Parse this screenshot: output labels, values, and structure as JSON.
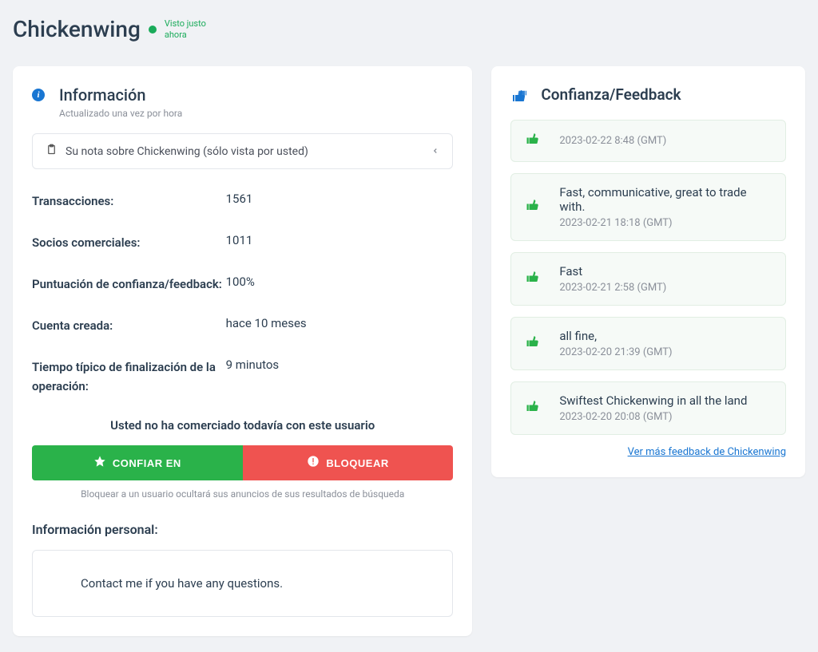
{
  "header": {
    "username": "Chickenwing",
    "status": "Visto justo ahora"
  },
  "info": {
    "title": "Información",
    "subtitle": "Actualizado una vez por hora",
    "note_label": "Su nota sobre Chickenwing (sólo vista por usted)",
    "rows": [
      {
        "label": "Transacciones:",
        "value": "1561"
      },
      {
        "label": "Socios comerciales:",
        "value": "1011"
      },
      {
        "label": "Puntuación de confianza/feedback:",
        "value": "100%"
      },
      {
        "label": "Cuenta creada:",
        "value": "hace 10 meses"
      },
      {
        "label": "Tiempo típico de finalización de la operación:",
        "value": "9 minutos"
      }
    ],
    "not_traded": "Usted no ha comerciado todavía con este usuario",
    "trust_button": "CONFIAR EN",
    "block_button": "BLOQUEAR",
    "block_hint": "Bloquear a un usuario ocultará sus anuncios de sus resultados de búsqueda",
    "personal_title": "Información personal:",
    "personal_text": "Contact me if you have any questions."
  },
  "trust": {
    "title": "Confianza/Feedback",
    "items": [
      {
        "msg": "",
        "date": "2023-02-22 8:48 (GMT)"
      },
      {
        "msg": "Fast, communicative, great to trade with.",
        "date": "2023-02-21 18:18 (GMT)"
      },
      {
        "msg": "Fast",
        "date": "2023-02-21 2:58 (GMT)"
      },
      {
        "msg": "all fine,",
        "date": "2023-02-20 21:39 (GMT)"
      },
      {
        "msg": "Swiftest Chickenwing in all the land",
        "date": "2023-02-20 20:08 (GMT)"
      }
    ],
    "more_link": "Ver más feedback de Chickenwing"
  }
}
